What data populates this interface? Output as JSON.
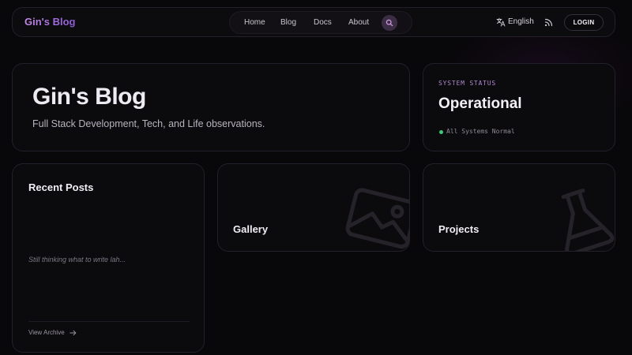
{
  "nav": {
    "logo": "Gin's Blog",
    "links": [
      {
        "label": "Home"
      },
      {
        "label": "Blog"
      },
      {
        "label": "Docs"
      },
      {
        "label": "About"
      }
    ],
    "language": "English",
    "login_label": "LOGIN"
  },
  "hero": {
    "title": "Gin's Blog",
    "subtitle": "Full Stack Development, Tech, and Life observations."
  },
  "status": {
    "label": "SYSTEM STATUS",
    "value": "Operational",
    "detail": "All Systems Normal",
    "indicator_color": "#3ec77a"
  },
  "recent_posts": {
    "title": "Recent Posts",
    "empty_text": "Still thinking what to write lah...",
    "archive_label": "View Archive"
  },
  "tiles": {
    "gallery": {
      "title": "Gallery",
      "icon": "image-icon"
    },
    "projects": {
      "title": "Projects",
      "icon": "flask-icon"
    }
  },
  "colors": {
    "accent": "#a46fe0",
    "background": "#080709"
  }
}
